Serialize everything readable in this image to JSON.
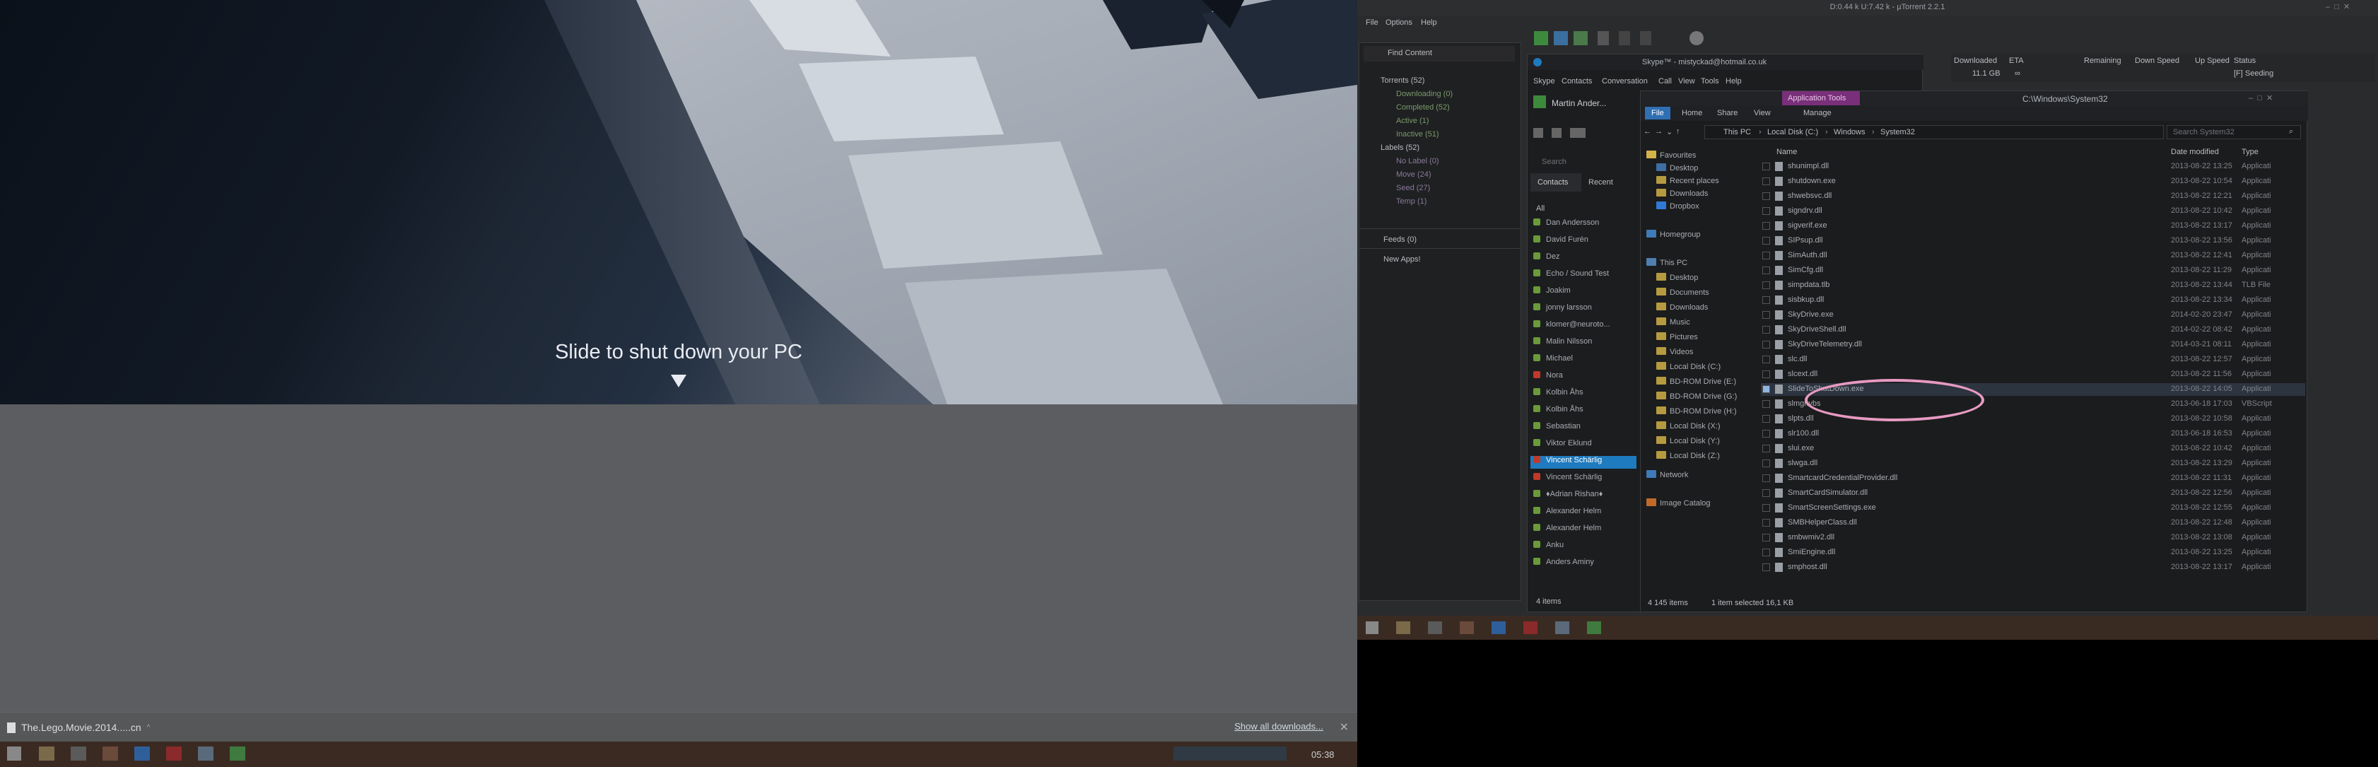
{
  "left_screen": {
    "slide_text": "Slide to shut down your PC",
    "download_item": "The.Lego.Movie.2014.....cn",
    "show_all": "Show all downloads...",
    "clock": "05:38",
    "close": "×"
  },
  "utorrent": {
    "title": "D:0.44 k U:7.42 k - µTorrent 2.2.1",
    "menu": [
      "File",
      "Options",
      "Help"
    ],
    "sidebar": [
      {
        "label": "Torrents (52)"
      },
      {
        "label": "Downloading (0)"
      },
      {
        "label": "Completed (52)"
      },
      {
        "label": "Active (1)"
      },
      {
        "label": "Inactive (51)"
      },
      {
        "label": "Labels (52)"
      },
      {
        "label": "No Label (0)"
      },
      {
        "label": "Move (24)"
      },
      {
        "label": "Seed (27)"
      },
      {
        "label": "Temp (1)"
      },
      {
        "label": "Feeds (0)"
      },
      {
        "label": "New Apps!"
      }
    ],
    "find_content": "Find Content",
    "columns": [
      "Downloaded",
      "ETA",
      "Remaining",
      "Down Speed",
      "Up Speed",
      "Status"
    ],
    "row": {
      "downloaded": "11.1 GB",
      "eta": "∞",
      "status": "[F] Seeding"
    }
  },
  "skype": {
    "title": "Skype™ - mistyckad@hotmail.co.uk",
    "menu": [
      "Skype",
      "Contacts",
      "Conversation",
      "Call",
      "View",
      "Tools",
      "Help"
    ],
    "user": "Martin Ander...",
    "search": "Search",
    "tabs": [
      "Contacts",
      "Recent"
    ],
    "filter": "All",
    "contacts": [
      "Dan Andersson",
      "David Furén",
      "Dez",
      "Echo / Sound Test",
      "Joakim",
      "jonny larsson",
      "klomer@neuroto...",
      "Malin Nilsson",
      "Michael",
      "Nora",
      "Kolbin Åhs",
      "Kolbin Åhs",
      "Sebastian",
      "Viktor Eklund",
      "Vincent Schärlig",
      "Vincent Schärlig",
      "♦Adrian Rishan♦",
      "Alexander Helm",
      "Alexander Helm",
      "Anku",
      "Anders Aminy"
    ],
    "status": "4 items"
  },
  "explorer": {
    "title": "C:\\Windows\\System32",
    "app_tools": "Application Tools",
    "ribbon_tabs": [
      "File",
      "Home",
      "Share",
      "View",
      "Manage"
    ],
    "path": [
      "This PC",
      "Local Disk (C:)",
      "Windows",
      "System32"
    ],
    "search_placeholder": "Search System32",
    "nav_favourites": [
      "Favourites",
      "Desktop",
      "Recent places",
      "Downloads",
      "Dropbox"
    ],
    "nav_homegroup": "Homegroup",
    "nav_thispc": [
      "This PC",
      "Desktop",
      "Documents",
      "Downloads",
      "Music",
      "Pictures",
      "Videos",
      "Local Disk (C:)",
      "BD-ROM Drive (E:)",
      "BD-ROM Drive (G:)",
      "BD-ROM Drive (H:)",
      "Local Disk (X:)",
      "Local Disk (Y:)",
      "Local Disk (Z:)"
    ],
    "nav_network": "Network",
    "nav_image": "Image Catalog",
    "columns": [
      "Name",
      "Date modified",
      "Type"
    ],
    "files": [
      {
        "name": "shunimpl.dll",
        "date": "2013-08-22 13:25",
        "type": "Applicati"
      },
      {
        "name": "shutdown.exe",
        "date": "2013-08-22 10:54",
        "type": "Applicati"
      },
      {
        "name": "shwebsvc.dll",
        "date": "2013-08-22 12:21",
        "type": "Applicati"
      },
      {
        "name": "signdrv.dll",
        "date": "2013-08-22 10:42",
        "type": "Applicati"
      },
      {
        "name": "sigverif.exe",
        "date": "2013-08-22 13:17",
        "type": "Applicati"
      },
      {
        "name": "SIPsup.dll",
        "date": "2013-08-22 13:56",
        "type": "Applicati"
      },
      {
        "name": "SimAuth.dll",
        "date": "2013-08-22 12:41",
        "type": "Applicati"
      },
      {
        "name": "SimCfg.dll",
        "date": "2013-08-22 11:29",
        "type": "Applicati"
      },
      {
        "name": "simpdata.tlb",
        "date": "2013-08-22 13:44",
        "type": "TLB File"
      },
      {
        "name": "sisbkup.dll",
        "date": "2013-08-22 13:34",
        "type": "Applicati"
      },
      {
        "name": "SkyDrive.exe",
        "date": "2014-02-20 23:47",
        "type": "Applicati"
      },
      {
        "name": "SkyDriveShell.dll",
        "date": "2014-02-22 08:42",
        "type": "Applicati"
      },
      {
        "name": "SkyDriveTelemetry.dll",
        "date": "2014-03-21 08:11",
        "type": "Applicati"
      },
      {
        "name": "slc.dll",
        "date": "2013-08-22 12:57",
        "type": "Applicati"
      },
      {
        "name": "slcext.dll",
        "date": "2013-08-22 11:56",
        "type": "Applicati"
      },
      {
        "name": "SlideToShutDown.exe",
        "date": "2013-08-22 14:05",
        "type": "Applicati"
      },
      {
        "name": "slmgr.vbs",
        "date": "2013-06-18 17:03",
        "type": "VBScript"
      },
      {
        "name": "slpts.dll",
        "date": "2013-08-22 10:58",
        "type": "Applicati"
      },
      {
        "name": "slr100.dll",
        "date": "2013-06-18 16:53",
        "type": "Applicati"
      },
      {
        "name": "slui.exe",
        "date": "2013-08-22 10:42",
        "type": "Applicati"
      },
      {
        "name": "slwga.dll",
        "date": "2013-08-22 13:29",
        "type": "Applicati"
      },
      {
        "name": "SmartcardCredentialProvider.dll",
        "date": "2013-08-22 11:31",
        "type": "Applicati"
      },
      {
        "name": "SmartCardSimulator.dll",
        "date": "2013-08-22 12:56",
        "type": "Applicati"
      },
      {
        "name": "SmartScreenSettings.exe",
        "date": "2013-08-22 12:55",
        "type": "Applicati"
      },
      {
        "name": "SMBHelperClass.dll",
        "date": "2013-08-22 12:48",
        "type": "Applicati"
      },
      {
        "name": "smbwmiv2.dll",
        "date": "2013-08-22 13:08",
        "type": "Applicati"
      },
      {
        "name": "SmiEngine.dll",
        "date": "2013-08-22 13:25",
        "type": "Applicati"
      },
      {
        "name": "smphost.dll",
        "date": "2013-08-22 13:17",
        "type": "Applicati"
      }
    ],
    "status_items": "4 145 items",
    "status_selected": "1 item selected  16,1 KB"
  },
  "colors": {
    "highlight_ring": "#e79ac1",
    "accent_blue": "#2f6fb3",
    "skype_blue": "#1e7bbf"
  }
}
